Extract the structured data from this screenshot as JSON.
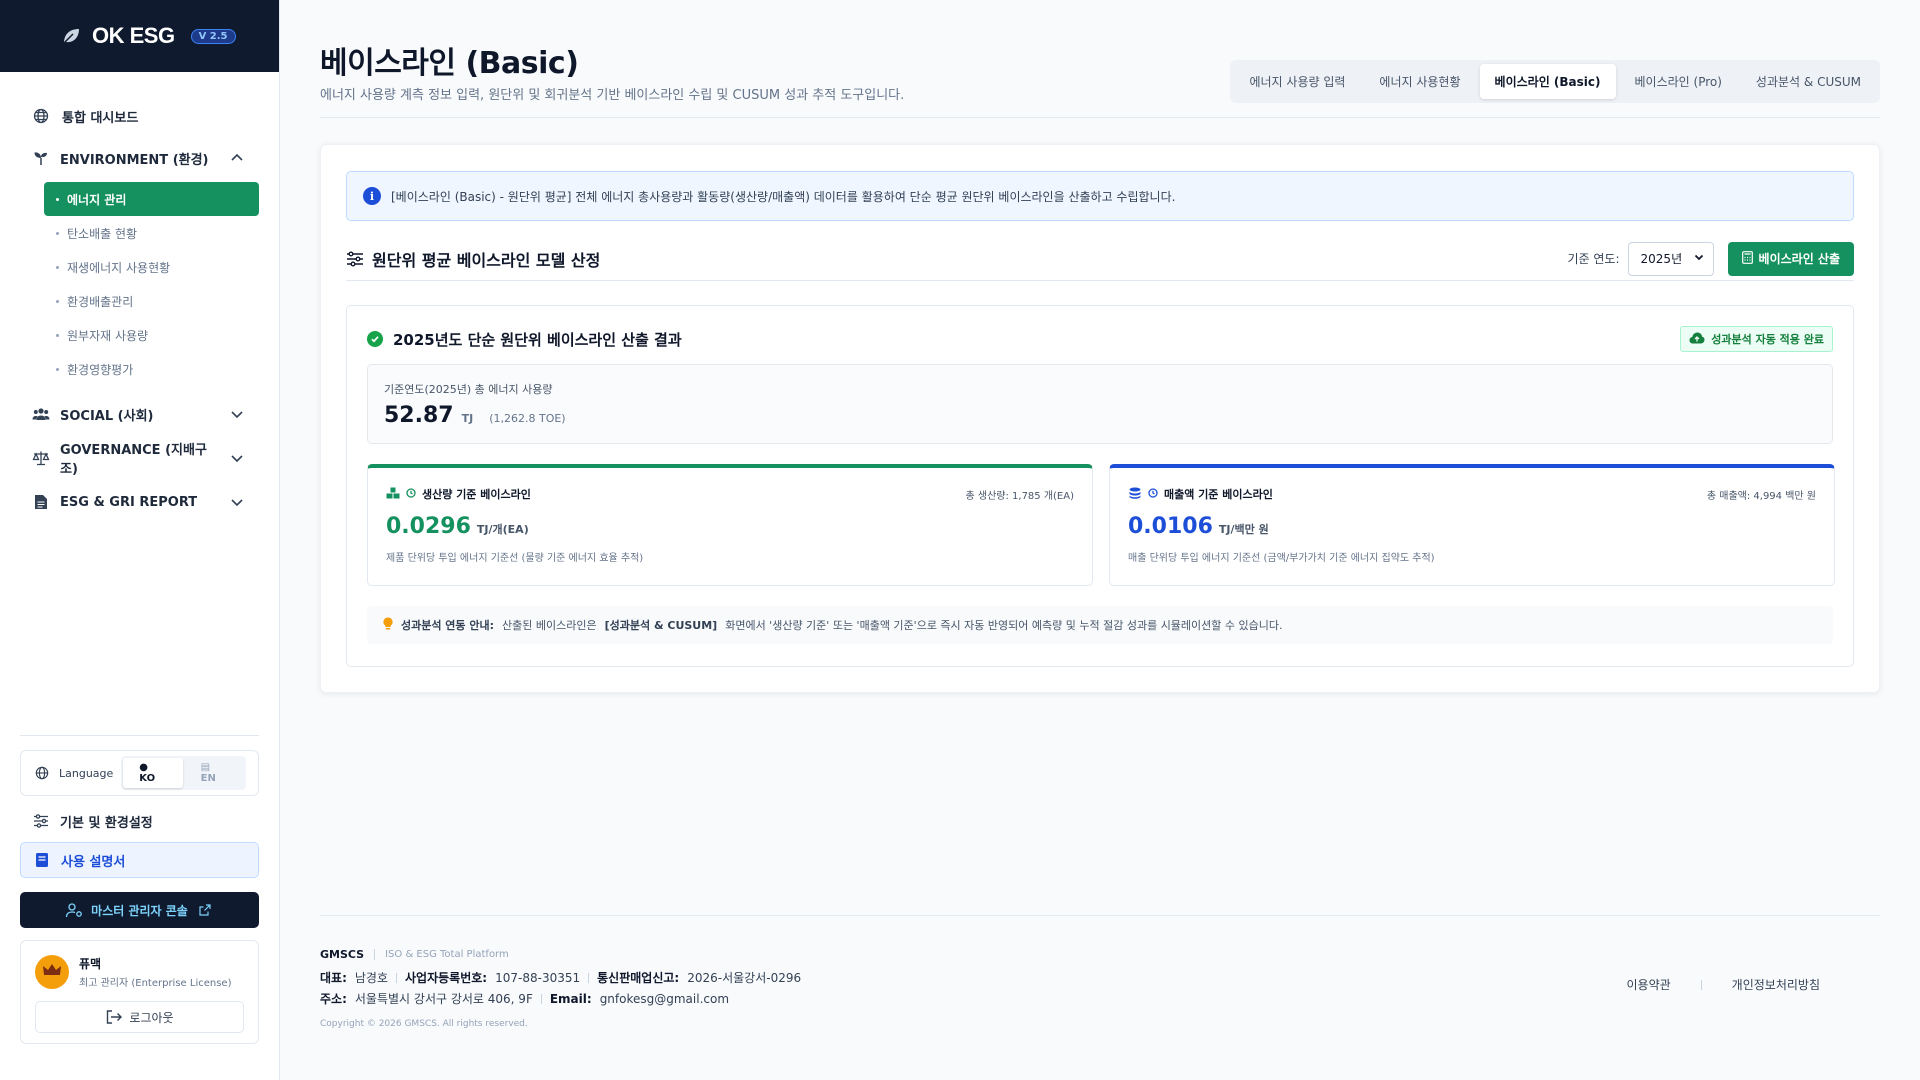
{
  "brand": {
    "name": "OK ESG",
    "version": "V 2.5"
  },
  "sidebar": {
    "dashboard": "통합 대시보드",
    "environment": {
      "label": "ENVIRONMENT (환경)",
      "items": [
        "에너지 관리",
        "탄소배출 현황",
        "재생에너지 사용현황",
        "환경배출관리",
        "원부자재 사용량",
        "환경영향평가"
      ]
    },
    "social": "SOCIAL (사회)",
    "governance": "GOVERNANCE (지배구조)",
    "report": "ESG & GRI REPORT",
    "language": {
      "label": "Language",
      "ko": "KO",
      "en": "EN"
    },
    "settings": "기본 및 환경설정",
    "manual": "사용 설명서",
    "master_console": "마스터 관리자 콘솔",
    "user": {
      "name": "퓨맥",
      "role": "최고 관리자 (Enterprise License)"
    },
    "logout": "로그아웃"
  },
  "header": {
    "title": "베이스라인 (Basic)",
    "subtitle": "에너지 사용량 계측 정보 입력, 원단위 및 회귀분석 기반 베이스라인 수립 및 CUSUM 성과 추적 도구입니다.",
    "tabs": [
      {
        "label": "에너지 사용량 입력",
        "active": false
      },
      {
        "label": "에너지 사용현황",
        "active": false
      },
      {
        "label": "베이스라인 (Basic)",
        "active": true
      },
      {
        "label": "베이스라인 (Pro)",
        "active": false
      },
      {
        "label": "성과분석 & CUSUM",
        "active": false
      }
    ]
  },
  "main": {
    "info": "[베이스라인 (Basic) - 원단위 평균] 전체 에너지 총사용량과 활동량(생산량/매출액) 데이터를 활용하여 단순 평균 원단위 베이스라인을 산출하고 수립합니다.",
    "section_title": "원단위 평균 베이스라인 모델 산정",
    "year_label": "기준 연도:",
    "year_value": "2025년",
    "calc_button": "베이스라인 산출",
    "result": {
      "title": "2025년도 단순 원단위 베이스라인 산출 결과",
      "auto_badge": "성과분석 자동 적용 완료",
      "total_label": "기준연도(2025년) 총 에너지 사용량",
      "total_value": "52.87",
      "total_unit": "TJ",
      "total_toe": "(1,262.8 TOE)",
      "production": {
        "title": "생산량 기준 베이스라인",
        "meta": "총 생산량: 1,785 개(EA)",
        "value": "0.0296",
        "unit": "TJ/개(EA)",
        "desc": "제품 단위당 투입 에너지 기준선 (물량 기준 에너지 효율 추적)"
      },
      "revenue": {
        "title": "매출액 기준 베이스라인",
        "meta": "총 매출액: 4,994 백만 원",
        "value": "0.0106",
        "unit": "TJ/백만 원",
        "desc": "매출 단위당 투입 에너지 기준선 (금액/부가가치 기준 에너지 집약도 추적)"
      },
      "note_bold": "성과분석 연동 안내:",
      "note_a": "산출된 베이스라인은",
      "note_link": "[성과분석 & CUSUM]",
      "note_b": "화면에서 '생산량 기준' 또는 '매출액 기준'으로 즉시 자동 반영되어 예측량 및 누적 절감 성과를 시뮬레이션할 수 있습니다."
    }
  },
  "footer": {
    "brand": "GMSCS",
    "tagline": "ISO & ESG Total Platform",
    "rep_label": "대표:",
    "rep": "남경호",
    "biz_label": "사업자등록번호:",
    "biz": "107-88-30351",
    "sales_label": "통신판매업신고:",
    "sales": "2026-서울강서-0296",
    "addr_label": "주소:",
    "addr": "서울특별시 강서구 강서로 406, 9F",
    "email_label": "Email:",
    "email": "gnfokesg@gmail.com",
    "copyright": "Copyright © 2026 GMSCS. All rights reserved.",
    "terms": "이용약관",
    "privacy": "개인정보처리방침"
  }
}
